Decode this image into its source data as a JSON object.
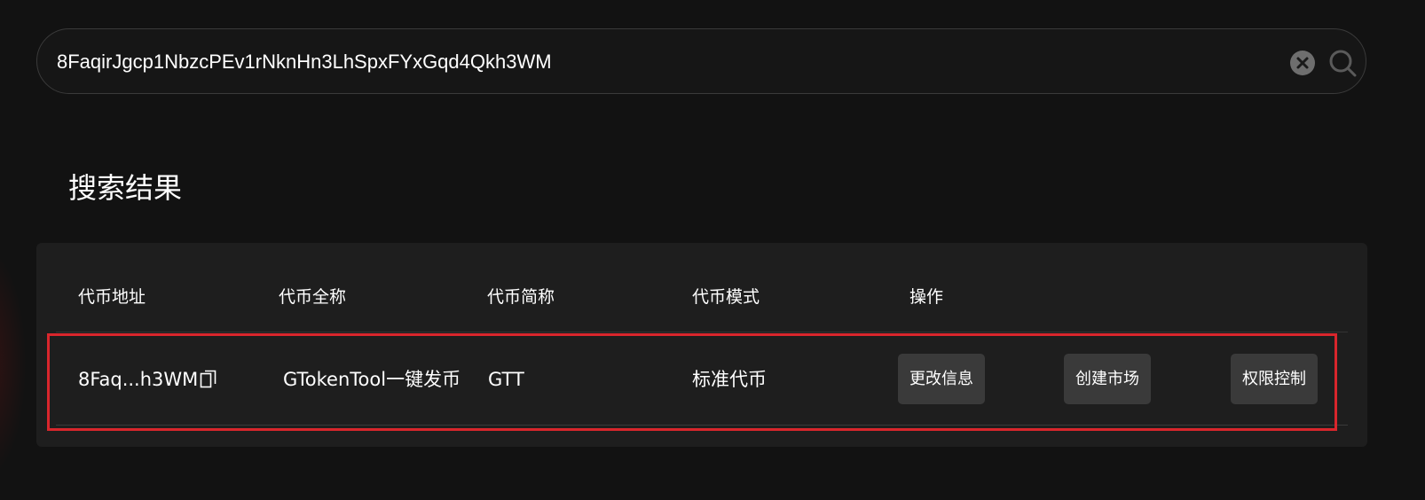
{
  "search": {
    "value": "8FaqirJgcp1NbzcPEv1rNknHn3LhSpxFYxGqd4Qkh3WM",
    "clear_icon": "clear-circle-x-icon",
    "search_icon": "magnifier-icon"
  },
  "results": {
    "title": "搜索结果",
    "columns": [
      "代币地址",
      "代币全称",
      "代币简称",
      "代币模式",
      "操作"
    ],
    "rows": [
      {
        "address_short": "8Faq...h3WM",
        "full_name": "GTokenTool一键发币",
        "symbol": "GTT",
        "mode": "标准代币",
        "actions": [
          "更改信息",
          "创建市场",
          "权限控制"
        ]
      }
    ]
  },
  "colors": {
    "background": "#121212",
    "panel": "#1e1e1e",
    "button": "#3a3a3a",
    "highlight_border": "#d9262c"
  }
}
